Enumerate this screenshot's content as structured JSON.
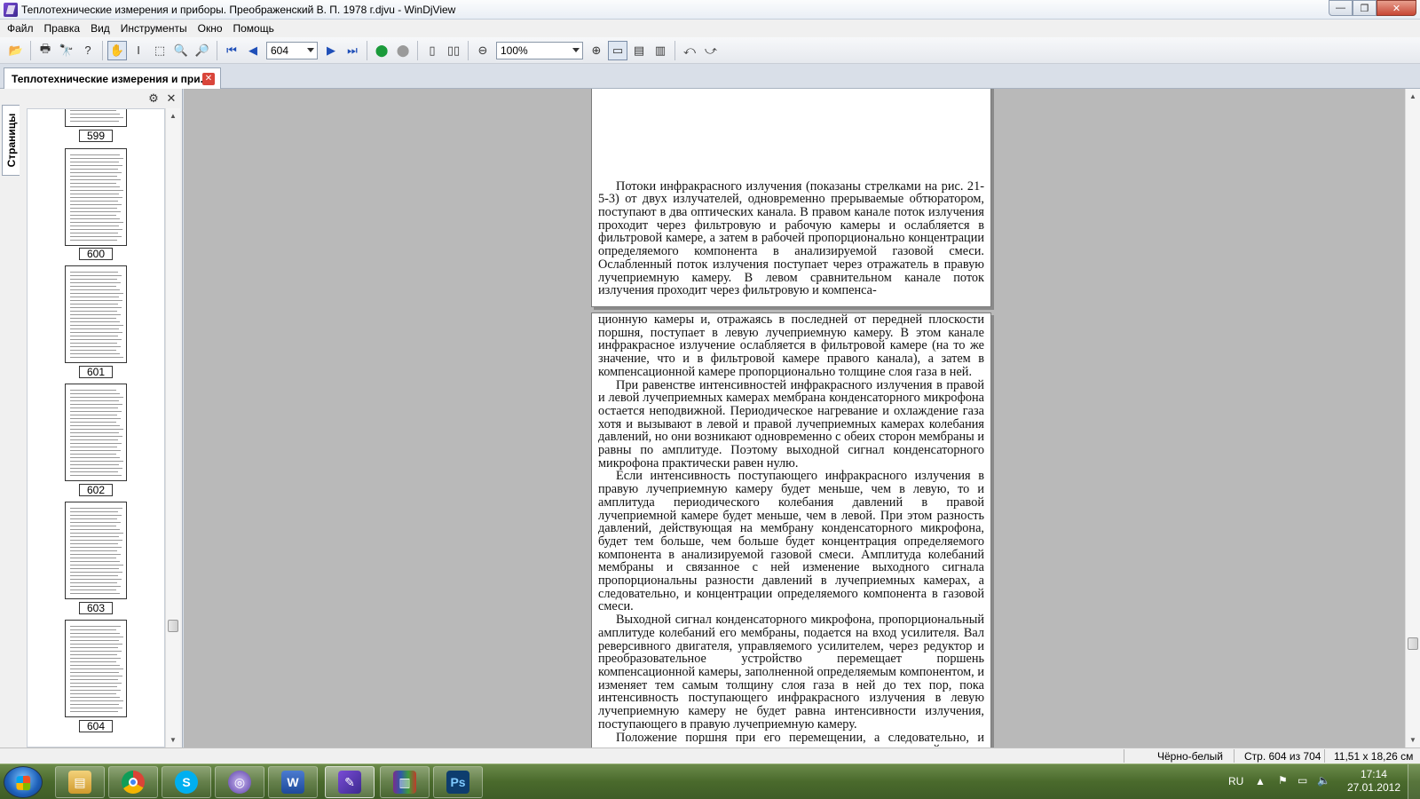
{
  "window": {
    "title": "Теплотехнические измерения и приборы. Преображенский В. П. 1978 г.djvu - WinDjView",
    "controls": {
      "minimize": "—",
      "maximize": "❐",
      "close": "✕"
    }
  },
  "menu": [
    "Файл",
    "Правка",
    "Вид",
    "Инструменты",
    "Окно",
    "Помощь"
  ],
  "toolbar": {
    "page_value": "604",
    "zoom_value": "100%"
  },
  "document_tab": {
    "label": "Теплотехнические измерения и при...",
    "close": "✕"
  },
  "sidebar": {
    "tab_label": "Страницы",
    "thumbnails": [
      "599",
      "600",
      "601",
      "602",
      "603",
      "604"
    ]
  },
  "page_top": {
    "paragraphs": [
      "Потоки инфракрасного излучения (показаны стрелками на рис. 21-5-3) от двух излучателей, одновременно прерываемые обтюратором, поступают в два оптических канала. В правом канале поток излучения проходит через фильтровую и рабочую камеры и ослабляется в фильтровой камере, а затем в рабочей пропорционально концентрации определяемого компонента в анализируемой газовой смеси. Ослабленный поток излучения поступает через отражатель в правую лучеприемную камеру. В левом сравнительном канале поток излучения проходит через фильтровую и компенса-"
    ]
  },
  "page_main": {
    "paragraphs": [
      "ционную камеры и, отражаясь в последней от передней плоскости поршня, поступает в левую лучеприемную камеру. В этом канале инфракрасное излучение ослабляется в фильтровой камере (на то же значение, что и в фильтровой камере правого канала), а затем в компенсационной камере пропорционально толщине слоя газа в ней.",
      "При равенстве интенсивностей инфракрасного излучения в правой и левой лучеприемных камерах мембрана конденсаторного микрофона остается неподвижной. Периодическое нагревание и охлаждение газа хотя и вызывают в левой и правой лучеприемных камерах колебания давлений, но они возникают одновременно с обеих сторон мембраны и равны по амплитуде. Поэтому выходной сигнал конденсаторного микрофона практически равен нулю.",
      "Если интенсивность поступающего инфракрасного излучения в правую лучеприемную камеру будет меньше, чем в левую, то и амплитуда периодического колебания давлений в правой лучеприемной камере будет меньше, чем в левой. При этом разность давлений, действующая на мембрану конденсаторного микрофона, будет тем больше, чем больше будет концентрация определяемого компонента в анализируемой газовой смеси. Амплитуда колебаний мембраны и связанное с ней изменение выходного сигнала пропорциональны разности давлений в лучеприемных камерах, а следовательно, и концентрации определяемого компонента в газовой смеси.",
      "Выходной сигнал конденсаторного микрофона, пропорциональный амплитуде колебаний его мембраны, подается на вход усилителя. Вал реверсивного двигателя, управляемого усилителем, через редуктор и преобразовательное устройство перемещает поршень компенсационной камеры, заполненной определяемым компонентом, и изменяет тем самым толщину слоя газа в ней до тех пор, пока интенсивность поступающего инфракрасного излучения в левую лучеприемную камеру не будет равна интенсивности излучения, поступающего в правую лучеприемную камеру.",
      "Положение поршня при его перемещении, а следовательно, и толщину слоя газа можно определить по вспомогательной шкале, нанесенной на вращающийся циферблат, жестко соединенный с каркасом реохорда (шкала на рис. 21-5-3 не показана). Таким образом, в пределах диапазона измерения прибора каждому значению концентрации определяемого компонента в анализируемой газовой смеси соответствует определенная толщина слоя этого же компо-"
    ]
  },
  "status": {
    "mode": "Чёрно-белый",
    "page_info": "Стр. 604 из 704",
    "page_size": "11,51 x 18,26 см"
  },
  "taskbar": {
    "apps": [
      "explorer-icon",
      "chrome-icon",
      "skype-icon",
      "orb-icon",
      "word-icon",
      "windjview-icon",
      "winrar-icon",
      "photoshop-icon"
    ],
    "language": "RU",
    "time": "17:14",
    "date": "27.01.2012"
  }
}
